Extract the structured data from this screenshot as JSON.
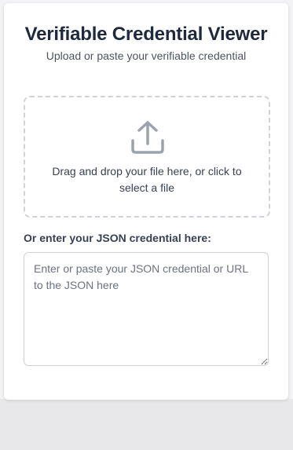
{
  "viewer": {
    "title": "Verifiable Credential Viewer",
    "subtitle": "Upload or paste your verifiable credential"
  },
  "dropzone": {
    "icon": "upload-icon",
    "text": "Drag and drop your file here, or click to select a file"
  },
  "json_entry": {
    "label": "Or enter your JSON credential here:",
    "placeholder": "Enter or paste your JSON credential or URL to the JSON here",
    "value": ""
  },
  "colors": {
    "title": "#1e2a3b",
    "icon": "#9ca3af",
    "border": "#cfd3d9"
  }
}
